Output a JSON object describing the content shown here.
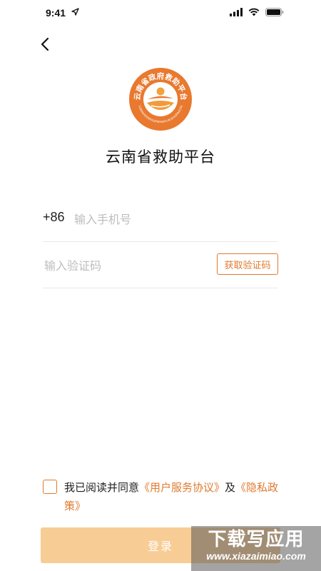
{
  "status_bar": {
    "time": "9:41"
  },
  "header": {
    "back": "back"
  },
  "app": {
    "title": "云南省救助平台",
    "logo_text": "云南省政府救助平台",
    "logo_sub": "YUNNANSHENGZHENGFUJIUZHUPINGTAI"
  },
  "form": {
    "country_code": "+86",
    "phone_placeholder": "输入手机号",
    "code_placeholder": "输入验证码",
    "get_code_label": "获取验证码"
  },
  "agreement": {
    "prefix": "我已阅读并同意",
    "user_agreement": "《用户服务协议》",
    "and": "及",
    "privacy_policy": "《隐私政策》"
  },
  "login_label": "登录",
  "watermark": {
    "main": "下载写应用",
    "sub": "www.xiazaimiao.com"
  },
  "colors": {
    "accent": "#e07a2e",
    "button": "#f8cc95",
    "logo_bg": "#e8792f"
  }
}
